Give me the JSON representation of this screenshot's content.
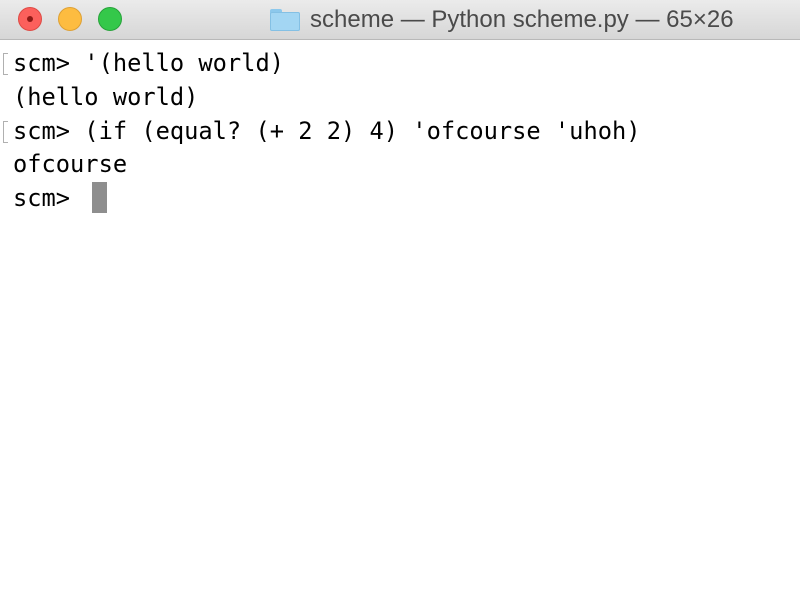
{
  "window": {
    "title": "scheme — Python scheme.py — 65×26"
  },
  "terminal": {
    "lines": [
      "scm> '(hello world)",
      "(hello world)",
      "scm> (if (equal? (+ 2 2) 4) 'ofcourse 'uhoh)",
      "ofcourse",
      "scm> "
    ]
  },
  "icons": {
    "title_icon": "folder-icon",
    "buttons": [
      "close-button-icon",
      "minimize-button-icon",
      "zoom-button-icon"
    ]
  },
  "colors": {
    "close": "#fc605c",
    "minimize": "#fdbc40",
    "zoom": "#34c84a",
    "folder": "#a3d6f3",
    "cursor": "#8e8e8e"
  }
}
